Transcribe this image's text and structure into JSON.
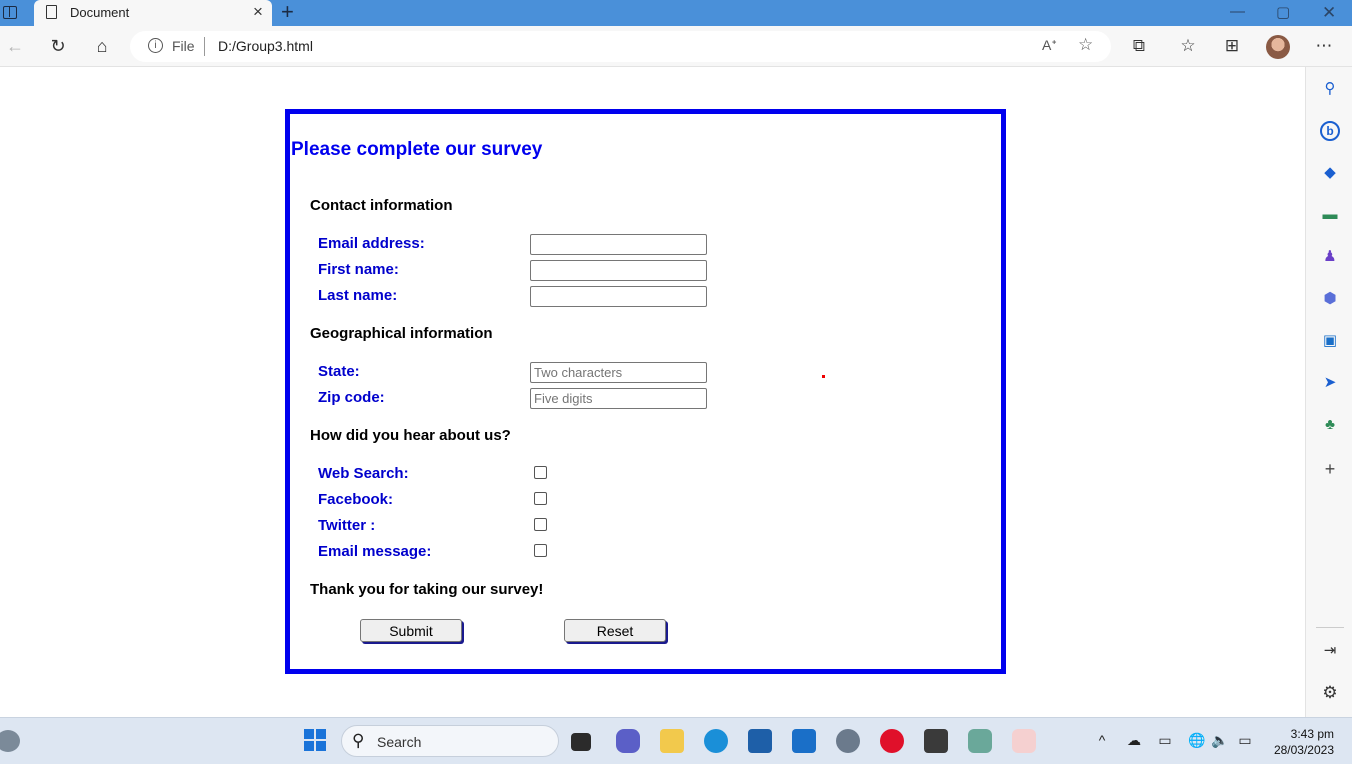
{
  "browser": {
    "tab_title": "Document",
    "tab_close_icon": "×",
    "new_tab_icon": "+",
    "address_scheme": "File",
    "address_url": "D:/Group3.html",
    "window_controls": [
      "—",
      "▢",
      "✕"
    ]
  },
  "survey": {
    "title": "Please complete our survey",
    "contact_heading": "Contact information",
    "email_label": "Email address:",
    "first_name_label": "First name:",
    "last_name_label": "Last name:",
    "geo_heading": "Geographical information",
    "state_label": "State:",
    "state_placeholder": "Two characters",
    "zip_label": "Zip code:",
    "zip_placeholder": "Five digits",
    "hear_heading": "How did you hear about us?",
    "web_search_label": "Web Search:",
    "facebook_label": "Facebook:",
    "twitter_label": "Twitter :",
    "email_message_label": "Email message:",
    "thanks": "Thank you for taking our survey!",
    "submit_label": "Submit",
    "reset_label": "Reset"
  },
  "taskbar": {
    "search_placeholder": "Search",
    "time": "3:43 pm",
    "date": "28/03/2023"
  },
  "colors": {
    "accent": "#0000ee",
    "label_blue": "#0000cc",
    "titlebar": "#4a90d9"
  }
}
